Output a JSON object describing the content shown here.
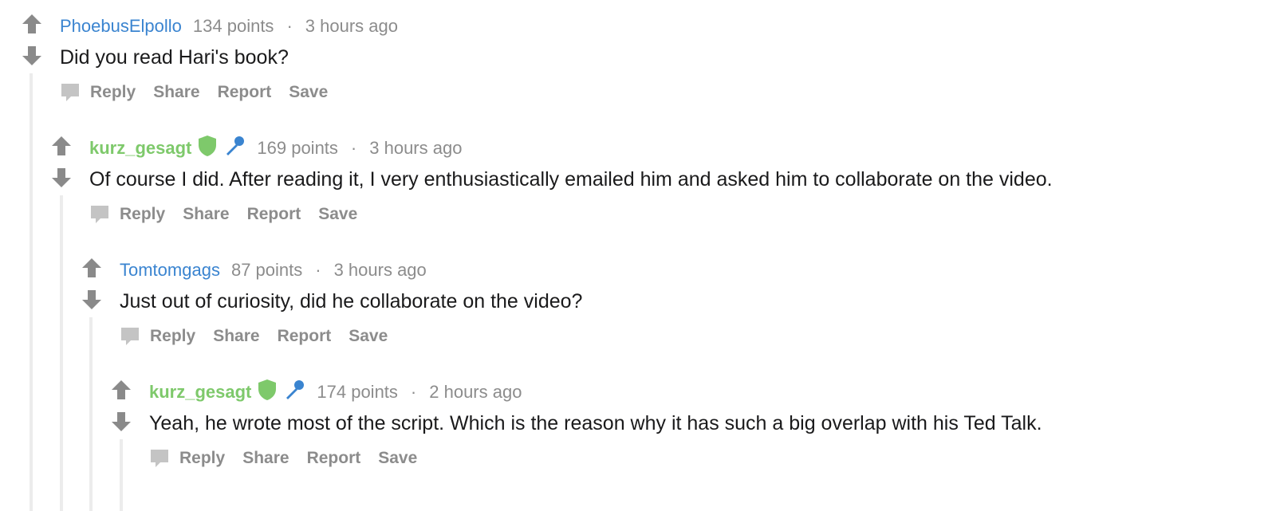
{
  "comments": [
    {
      "author": "PhoebusElpollo",
      "is_op": false,
      "points": "134 points",
      "separator": "·",
      "time": "3 hours ago",
      "body": "Did you read Hari's book?",
      "actions": [
        "Reply",
        "Share",
        "Report",
        "Save"
      ]
    },
    {
      "author": "kurz_gesagt",
      "is_op": true,
      "flair_icons": [
        "shield-icon",
        "microphone-icon"
      ],
      "points": "169 points",
      "separator": "·",
      "time": "3 hours ago",
      "body": "Of course I did. After reading it, I very enthusiastically emailed him and asked him to collaborate on the video.",
      "actions": [
        "Reply",
        "Share",
        "Report",
        "Save"
      ]
    },
    {
      "author": "Tomtomgags",
      "is_op": false,
      "points": "87 points",
      "separator": "·",
      "time": "3 hours ago",
      "body": "Just out of curiosity, did he collaborate on the video?",
      "actions": [
        "Reply",
        "Share",
        "Report",
        "Save"
      ]
    },
    {
      "author": "kurz_gesagt",
      "is_op": true,
      "flair_icons": [
        "shield-icon",
        "microphone-icon"
      ],
      "points": "174 points",
      "separator": "·",
      "time": "2 hours ago",
      "body": "Yeah, he wrote most of the script. Which is the reason why it has such a big overlap with his Ted Talk.",
      "actions": [
        "Reply",
        "Share",
        "Report",
        "Save"
      ]
    }
  ],
  "colors": {
    "author_link": "#3a84d0",
    "op_author": "#7ec96b",
    "meta_gray": "#8c8c8c",
    "vote_arrow": "#8a8a8a",
    "shield": "#7ec96b",
    "microphone": "#3a84d0",
    "thread_line": "#ececec"
  }
}
